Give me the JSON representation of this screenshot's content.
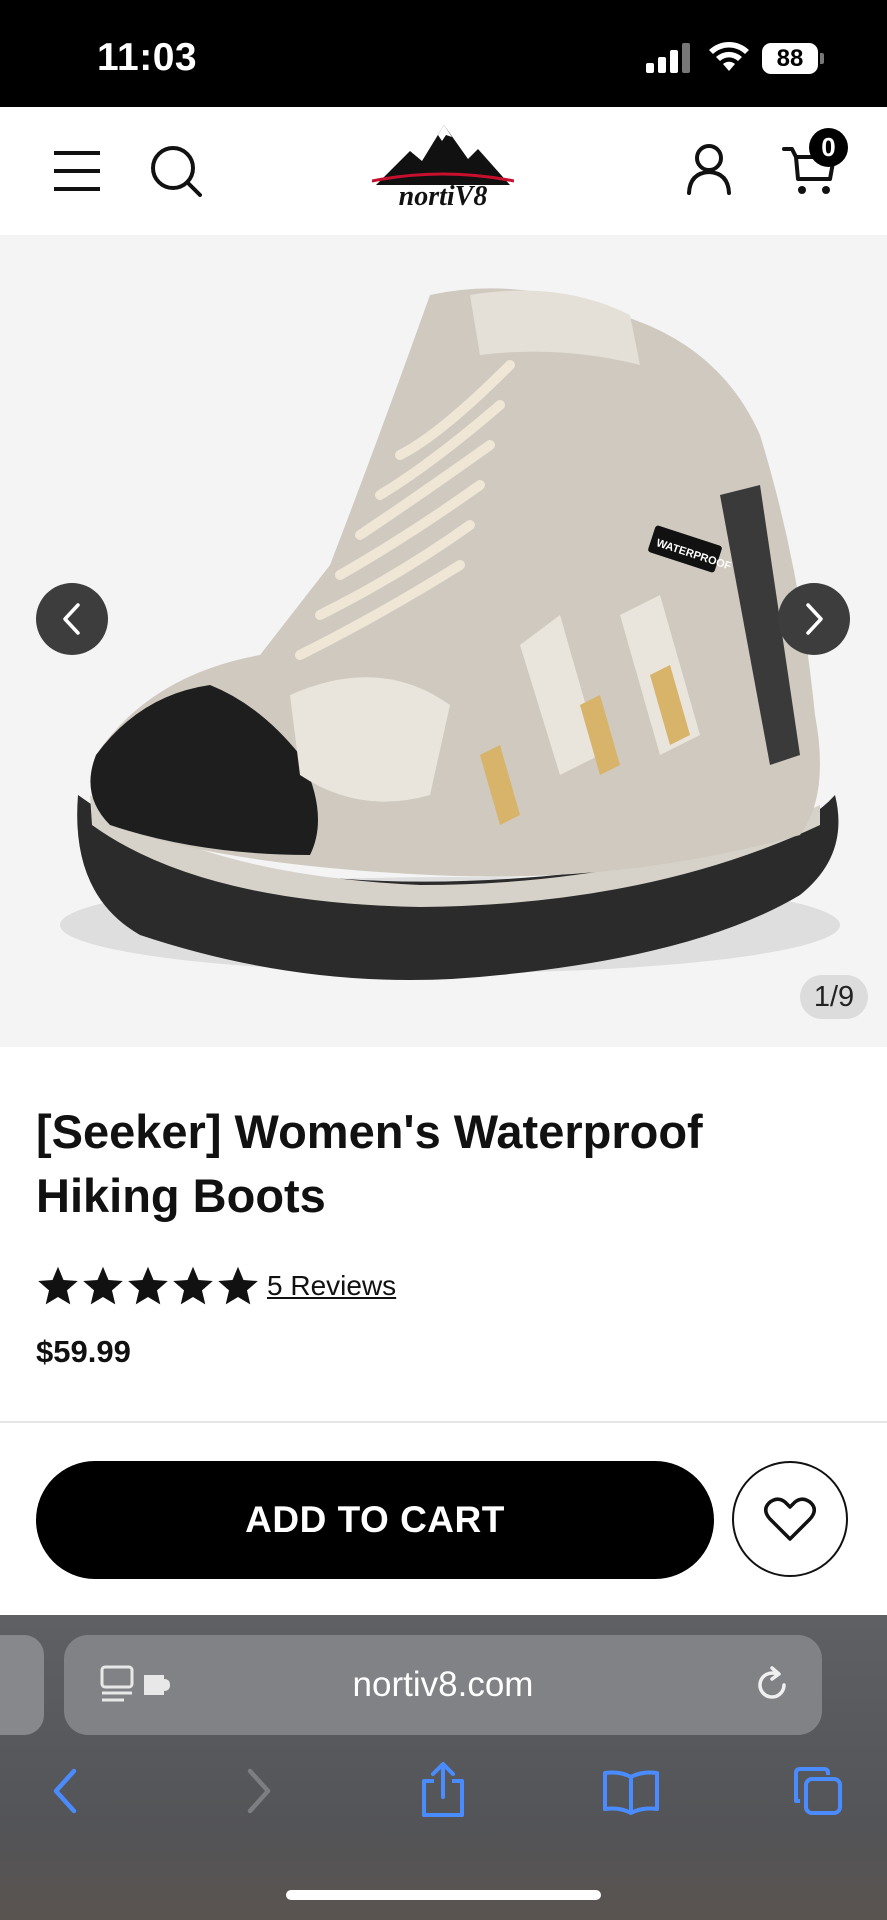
{
  "status_bar": {
    "time": "11:03",
    "battery": "88"
  },
  "header": {
    "brand": "nortiV8",
    "cart_count": "0"
  },
  "gallery": {
    "counter": "1/9",
    "current_index": 1,
    "total": 9
  },
  "product": {
    "title": "[Seeker] Women's Waterproof Hiking Boots",
    "rating": 5,
    "reviews_label": "5 Reviews",
    "price": "$59.99",
    "tag": "WATERPROOF"
  },
  "actions": {
    "add_to_cart_label": "ADD TO CART"
  },
  "browser": {
    "url": "nortiv8.com"
  },
  "colors": {
    "accent": "#000000",
    "brand_red": "#c8102e",
    "safari_blue": "#4a8cff"
  }
}
